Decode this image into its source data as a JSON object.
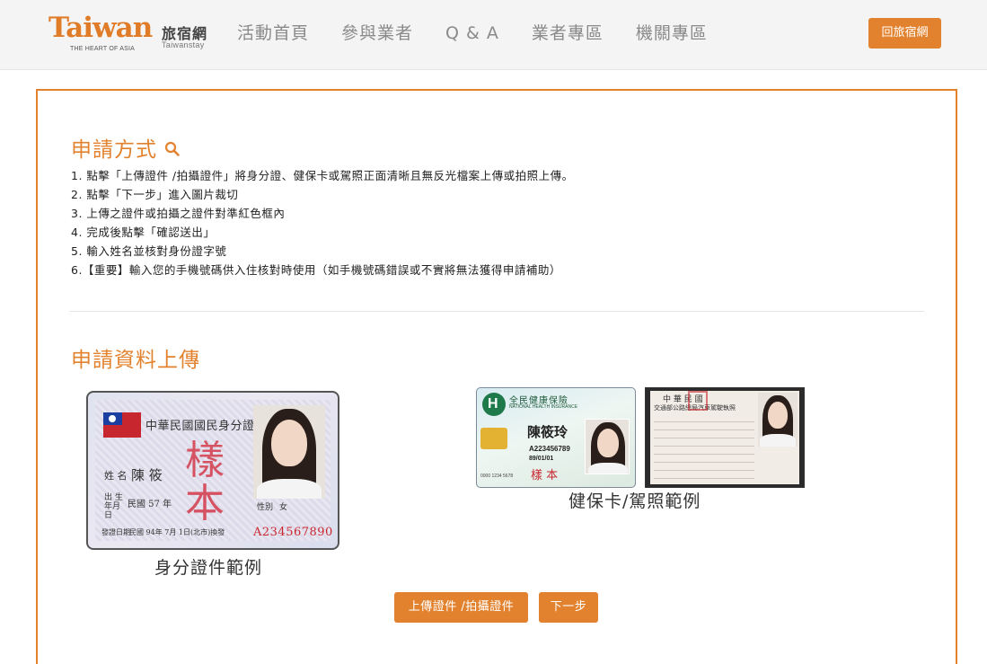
{
  "header": {
    "logo_word": "Taiwan",
    "logo_cn": "旅宿網",
    "logo_tagline": "THE HEART OF ASIA",
    "logo_sub": "Taiwanstay",
    "nav": [
      "活動首頁",
      "參與業者",
      "Q & A",
      "業者專區",
      "機關專區"
    ],
    "back_button": "回旅宿網"
  },
  "apply_method": {
    "title": "申請方式",
    "steps": [
      "1. 點擊「上傳證件 /拍攝證件」將身分證、健保卡或駕照正面清晰且無反光檔案上傳或拍照上傳。",
      "2. 點擊「下一步」進入圖片裁切",
      "3. 上傳之證件或拍攝之證件對準紅色框內",
      "4. 完成後點擊「確認送出」",
      "5. 輸入姓名並核對身份證字號",
      "6.【重要】輸入您的手機號碼供入住核對時使用（如手機號碼錯誤或不實將無法獲得申請補助）"
    ]
  },
  "upload": {
    "title": "申請資料上傳",
    "id_card": {
      "caption": "身分證件範例",
      "card_title": "中華民國國民身分證",
      "name_label": "姓 名",
      "name_value": "陳  筱",
      "birth_label": "出 生\n年月日",
      "birth_value": "民國  57  年",
      "gender_label": "性別",
      "gender_value": "女",
      "issue_label": "發證日期",
      "issue_value": "民國 94年 7月 1日(北市)換發",
      "id_number": "A234567890",
      "stamp": "樣本"
    },
    "nhi_card": {
      "header_cn": "全民健康保險",
      "header_en": "NATIONAL HEALTH INSURANCE",
      "name": "陳筱玲",
      "id_number": "A223456789",
      "birth": "89/01/01",
      "card_no": "0000 1234 5678",
      "stamp": "樣  本"
    },
    "license_card": {
      "header": "中   華   民   國",
      "authority": "交通部公路總局汽車駕駛執照"
    },
    "nhi_caption": "健保卡/駕照範例",
    "upload_button": "上傳證件 /拍攝證件",
    "next_button": "下一步"
  },
  "colors": {
    "accent": "#e2822e",
    "nav_text": "#8a8a8a"
  }
}
